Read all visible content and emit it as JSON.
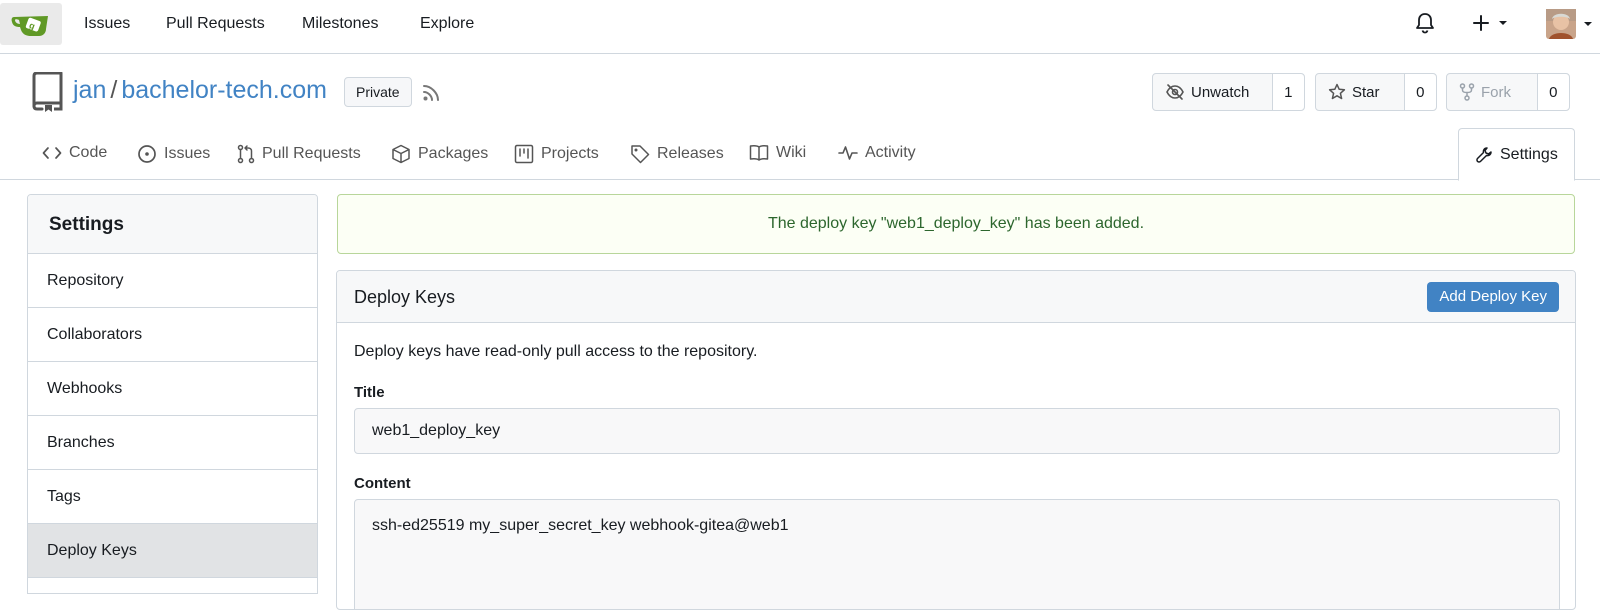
{
  "nav": {
    "items": [
      "Issues",
      "Pull Requests",
      "Milestones",
      "Explore"
    ]
  },
  "repo": {
    "owner": "jan",
    "separator": "/",
    "name": "bachelor-tech.com",
    "visibility": "Private",
    "unwatch_label": "Unwatch",
    "watch_count": "1",
    "star_label": "Star",
    "star_count": "0",
    "fork_label": "Fork",
    "fork_count": "0"
  },
  "tabs": [
    "Code",
    "Issues",
    "Pull Requests",
    "Packages",
    "Projects",
    "Releases",
    "Wiki",
    "Activity",
    "Settings"
  ],
  "sidebar": {
    "title": "Settings",
    "items": [
      "Repository",
      "Collaborators",
      "Webhooks",
      "Branches",
      "Tags",
      "Deploy Keys"
    ]
  },
  "flash": {
    "message": "The deploy key \"web1_deploy_key\" has been added."
  },
  "deploy_keys": {
    "title": "Deploy Keys",
    "add_label": "Add Deploy Key",
    "description": "Deploy keys have read-only pull access to the repository.",
    "title_label": "Title",
    "title_value": "web1_deploy_key",
    "content_label": "Content",
    "content_value": "ssh-ed25519 my_super_secret_key webhook-gitea@web1"
  },
  "colors": {
    "accent": "#4183c4",
    "success_text": "#2c662d",
    "success_border": "#b8d69a",
    "logo_green": "#609926"
  }
}
